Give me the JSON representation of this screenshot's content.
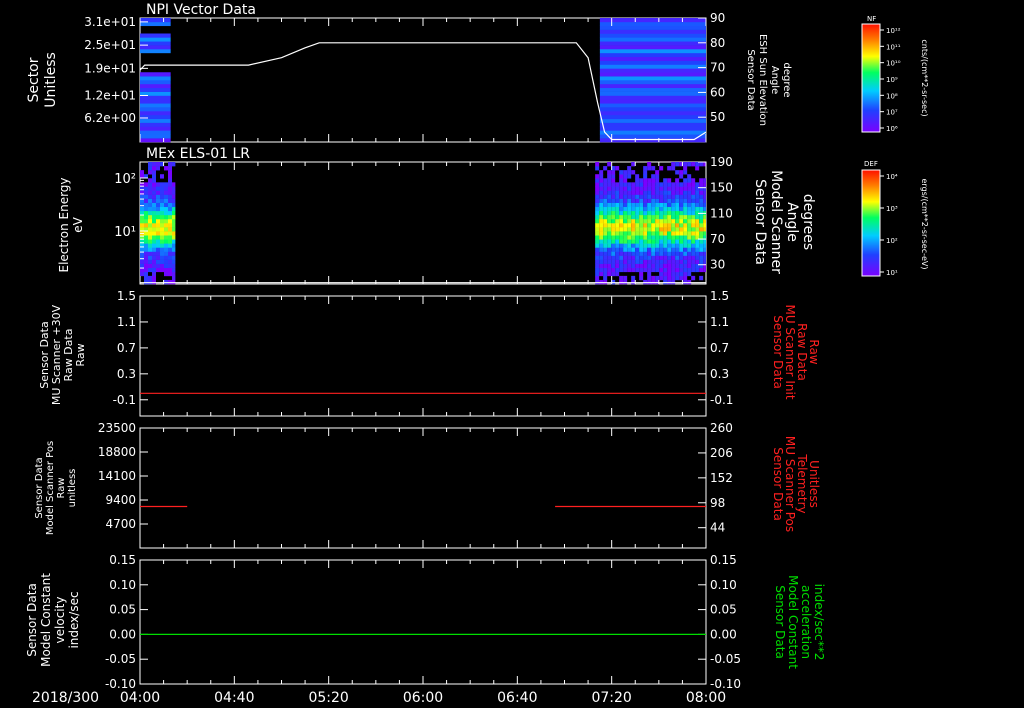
{
  "time_axis": {
    "date_label": "2018/300",
    "start": "04:00",
    "end": "08:00",
    "start_min": 240,
    "end_min": 480,
    "ticks": [
      "04:00",
      "04:40",
      "05:20",
      "06:00",
      "06:40",
      "07:20",
      "08:00"
    ]
  },
  "colors": {
    "background": "#000000",
    "axes": "#ffffff",
    "red_trace": "#ff2020",
    "green_trace": "#00dd00"
  },
  "chart_data": [
    {
      "type": "heatmap",
      "title": "NPI Vector Data",
      "ylabel": [
        "Sector",
        "Unitless"
      ],
      "yticks": [
        "3.1e+01",
        "2.5e+01",
        "1.9e+01",
        "1.2e+01",
        "6.2e+00"
      ],
      "ylim": [
        0,
        32
      ],
      "right_axis": {
        "label": [
          "Sensor Data",
          "ESH Sun Elevation",
          "Angle",
          "degree"
        ],
        "ticks": [
          90,
          80,
          70,
          60,
          50
        ],
        "ylim": [
          40,
          90
        ]
      },
      "colorbar": {
        "name": "NF",
        "unit": "cnts/(cm**2-sr-sec)",
        "ticks": [
          "10¹²",
          "10¹¹",
          "10¹⁰",
          "10⁹",
          "10⁸",
          "10⁷",
          "10⁶"
        ]
      },
      "data_intervals": [
        [
          "04:00",
          "04:13"
        ],
        [
          "07:15",
          "08:00"
        ]
      ],
      "line_series": {
        "name": "ESH Sun Elevation Angle",
        "x": [
          "04:00",
          "04:02",
          "04:46",
          "05:00",
          "05:10",
          "05:16",
          "05:20",
          "06:00",
          "06:40",
          "07:05",
          "07:10",
          "07:14",
          "07:17",
          "07:20",
          "07:55",
          "08:00"
        ],
        "y": [
          69,
          71,
          71,
          74,
          78,
          80,
          80,
          80,
          80,
          80,
          74,
          56,
          44,
          41,
          41,
          44
        ]
      }
    },
    {
      "type": "heatmap",
      "title": "MEx ELS-01 LR",
      "ylabel": [
        "Electron Energy",
        "eV"
      ],
      "yscale": "log",
      "yticks": [
        "10²",
        "10¹"
      ],
      "ylim": [
        1,
        200
      ],
      "right_axis": {
        "label": [
          "Sensor Data",
          "Model Scanner",
          "Angle",
          "degrees"
        ],
        "ticks": [
          190,
          150,
          110,
          70,
          30
        ],
        "ylim": [
          0,
          190
        ]
      },
      "colorbar": {
        "name": "DEF",
        "unit": "ergs/(cm**2-sr-sec-eV)",
        "ticks": [
          "10⁴",
          "10³",
          "10²",
          "10¹"
        ]
      },
      "data_intervals": [
        [
          "04:00",
          "04:15"
        ],
        [
          "07:13",
          "08:00"
        ]
      ],
      "line_series": {
        "name": "Model Scanner Angle",
        "x": [
          "04:00",
          "08:00"
        ],
        "y": [
          2,
          2
        ]
      }
    },
    {
      "type": "line",
      "ylabel": [
        "Sensor Data",
        "MU Scanner +30V",
        "Raw Data",
        "Raw"
      ],
      "yticks": [
        "1.5",
        "1.1",
        "0.7",
        "0.3",
        "-0.1"
      ],
      "ylim": [
        -0.35,
        1.5
      ],
      "right_axis": {
        "label": [
          "Sensor Data",
          "MU Scanner Init",
          "Raw Data",
          "Raw"
        ],
        "ticks": [
          "1.5",
          "1.1",
          "0.7",
          "0.3",
          "-0.1"
        ],
        "ylim": [
          -0.35,
          1.5
        ]
      },
      "series": [
        {
          "name": "MU Scanner Init Raw Data",
          "color": "#ff2020",
          "segments": [
            {
              "x": [
                "04:00",
                "08:00"
              ],
              "y": [
                0,
                0
              ]
            }
          ]
        }
      ]
    },
    {
      "type": "line",
      "ylabel": [
        "Sensor Data",
        "Model Scanner Pos",
        "Raw",
        "unitless"
      ],
      "yticks": [
        "23500",
        "18800",
        "14100",
        "9400",
        "4700"
      ],
      "ylim": [
        0,
        23500
      ],
      "right_axis": {
        "label": [
          "Sensor Data",
          "MU Scanner Pos",
          "Telemetry",
          "Unitless"
        ],
        "ticks": [
          "260",
          "206",
          "152",
          "98",
          "44"
        ],
        "ylim": [
          0,
          260
        ]
      },
      "series": [
        {
          "name": "MU Scanner Pos Telemetry",
          "color": "#ff2020",
          "axis": "right",
          "segments": [
            {
              "x": [
                "04:00",
                "04:20"
              ],
              "y": [
                90,
                90
              ]
            },
            {
              "x": [
                "06:56",
                "08:00"
              ],
              "y": [
                90,
                90
              ]
            }
          ]
        }
      ]
    },
    {
      "type": "line",
      "ylabel": [
        "Sensor Data",
        "Model Constant",
        "velocity",
        "index/sec"
      ],
      "yticks": [
        "0.15",
        "0.10",
        "0.05",
        "0.00",
        "-0.05",
        "-0.10"
      ],
      "ylim": [
        -0.1,
        0.15
      ],
      "right_axis": {
        "label": [
          "Sensor Data",
          "Model Constant",
          "acceleration",
          "index/sec**2"
        ],
        "ticks": [
          "0.15",
          "0.10",
          "0.05",
          "0.00",
          "-0.05",
          "-0.10"
        ],
        "ylim": [
          -0.1,
          0.15
        ]
      },
      "series": [
        {
          "name": "Model Constant acceleration",
          "color": "#00dd00",
          "segments": [
            {
              "x": [
                "04:00",
                "08:00"
              ],
              "y": [
                0,
                0
              ]
            }
          ]
        }
      ]
    }
  ]
}
